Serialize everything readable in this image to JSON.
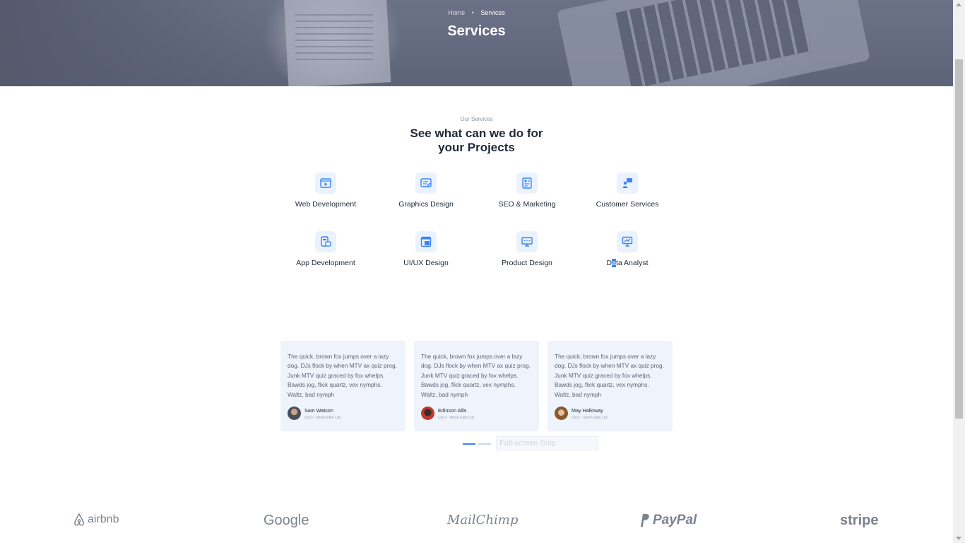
{
  "hero": {
    "breadcrumb_home": "Home",
    "breadcrumb_separator": "•",
    "breadcrumb_current": "Services",
    "title": "Services"
  },
  "section": {
    "eyebrow": "Our Services",
    "title": "See what can we do for your Projects"
  },
  "services": [
    {
      "label": "Web Development",
      "icon": "video-browser-icon"
    },
    {
      "label": "Graphics Design",
      "icon": "design-board-icon"
    },
    {
      "label": "SEO & Marketing",
      "icon": "seo-report-icon"
    },
    {
      "label": "Customer Services",
      "icon": "support-chat-icon"
    },
    {
      "label": "App Development",
      "icon": "app-window-icon"
    },
    {
      "label": "UI/UX Design",
      "icon": "layout-icon"
    },
    {
      "label": "Product Design",
      "icon": "monitor-icon"
    },
    {
      "label": "Data Analyst",
      "icon": "chart-board-icon"
    }
  ],
  "data_analyst_label": {
    "before": "D",
    "selected": "a",
    "after": "ta Analyst"
  },
  "testimonials": [
    {
      "quote": "The quick, brown fox jumps over a lazy dog. DJs flock by when MTV ax quiz prog. Junk MTV quiz graced by fox whelps. Bawds jog, flick quartz, vex nymphs. Waltz, bad nymph",
      "name": "Sam Watson",
      "role": "CEO - Mosh Elite Ltd."
    },
    {
      "quote": "The quick, brown fox jumps over a lazy dog. DJs flock by when MTV ax quiz prog. Junk MTV quiz graced by fox whelps. Bawds jog, flick quartz, vex nymphs. Waltz, bad nymph",
      "name": "Edinson Alfa",
      "role": "CEO - Mosh Elite Ltd."
    },
    {
      "quote": "The quick, brown fox jumps over a lazy dog. DJs flock by when MTV ax quiz prog. Junk MTV quiz graced by fox whelps. Bawds jog, flick quartz, vex nymphs. Waltz, bad nymph",
      "name": "May Halloway",
      "role": "CEO - Mosh Elite Ltd."
    }
  ],
  "carousel": {
    "pages": 2,
    "active_page": 1
  },
  "snip_overlay": "Full-screen Snip",
  "logos": [
    "airbnb",
    "Google",
    "MailChimp",
    "PayPal",
    "stripe"
  ],
  "colors": {
    "accent": "#3b82f6",
    "icon_bg": "#eaf2fe",
    "card_bg": "#eef3fc",
    "hero_overlay": "#5e6478"
  }
}
